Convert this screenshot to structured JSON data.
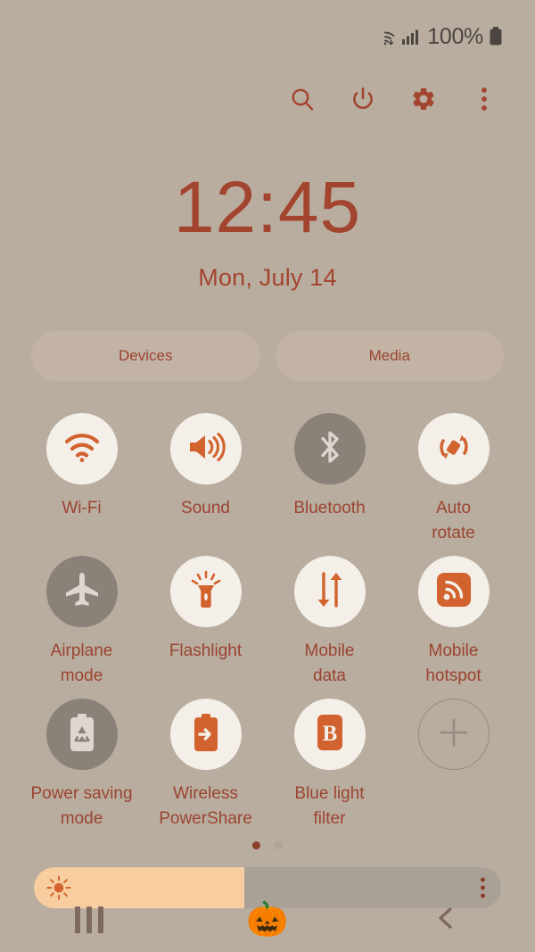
{
  "statusbar": {
    "wifi_icon": "wifi-signal-icon",
    "cellular_icon": "cellular-bars-icon",
    "battery_percent": "100%",
    "battery_icon": "battery-full-icon"
  },
  "toolbar": {
    "buttons": [
      {
        "name": "search-button",
        "icon": "search-icon"
      },
      {
        "name": "power-button",
        "icon": "power-icon"
      },
      {
        "name": "settings-button",
        "icon": "gear-icon"
      },
      {
        "name": "more-options-button",
        "icon": "three-dots-vertical-icon"
      }
    ],
    "accent_color": "#a3442f"
  },
  "clock": {
    "time": "12:45",
    "date": "Mon, July 14"
  },
  "shortcuts": {
    "devices_label": "Devices",
    "media_label": "Media"
  },
  "tiles": [
    {
      "label": "Wi-Fi",
      "icon": "wifi-icon",
      "state": "on"
    },
    {
      "label": "Sound",
      "icon": "speaker-icon",
      "state": "on"
    },
    {
      "label": "Bluetooth",
      "icon": "bluetooth-icon",
      "state": "off"
    },
    {
      "label": "Auto\nrotate",
      "icon": "auto-rotate-icon",
      "state": "on"
    },
    {
      "label": "Airplane\nmode",
      "icon": "airplane-icon",
      "state": "off"
    },
    {
      "label": "Flashlight",
      "icon": "flashlight-icon",
      "state": "on"
    },
    {
      "label": "Mobile\ndata",
      "icon": "data-arrows-icon",
      "state": "on"
    },
    {
      "label": "Mobile\nhotspot",
      "icon": "hotspot-icon",
      "state": "on"
    },
    {
      "label": "Power saving\nmode",
      "icon": "battery-eco-icon",
      "state": "off"
    },
    {
      "label": "Wireless\nPowerShare",
      "icon": "powershare-icon",
      "state": "on"
    },
    {
      "label": "Blue light\nfilter",
      "icon": "blue-light-b-icon",
      "state": "on"
    },
    {
      "label": "",
      "icon": "plus-icon",
      "state": "add"
    }
  ],
  "pager": {
    "pages": 2,
    "active_index": 0
  },
  "brightness": {
    "level_percent": 45,
    "sun_icon": "sun-icon",
    "menu_icon": "three-dots-vertical-icon"
  },
  "navbar": {
    "recents_icon": "recents-bars-icon",
    "home_icon": "🎃",
    "back_icon": "back-chevron-icon"
  },
  "colors": {
    "background": "#b9ad9f",
    "accent_red": "#a3442f",
    "icon_orange": "#d2622e",
    "tile_on_bg": "#f4efe8",
    "tile_off_bg": "#8a8178",
    "slider_fill": "#f8cea1"
  }
}
